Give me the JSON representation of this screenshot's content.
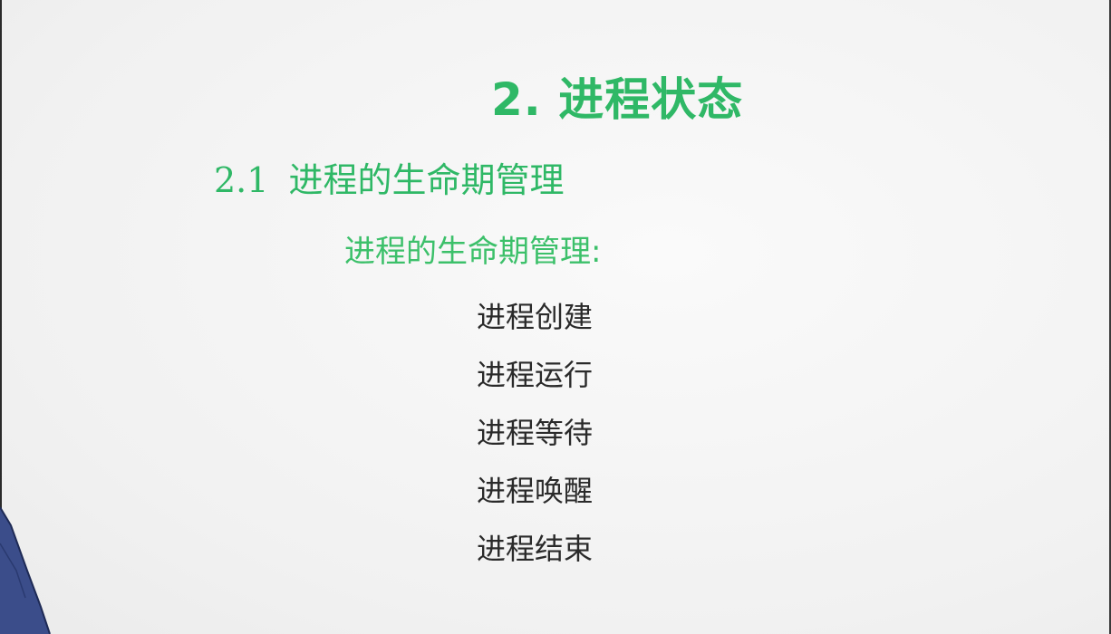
{
  "slide": {
    "title": "2. 进程状态",
    "subsection": {
      "number": "2.1",
      "label": "进程的生命期管理"
    },
    "heading": "进程的生命期管理:",
    "items": [
      "进程创建",
      "进程运行",
      "进程等待",
      "进程唤醒",
      "进程结束"
    ]
  },
  "colors": {
    "accent_green": "#2fb866",
    "body_text": "#2a2a2a",
    "background": "#f4f4f4"
  }
}
